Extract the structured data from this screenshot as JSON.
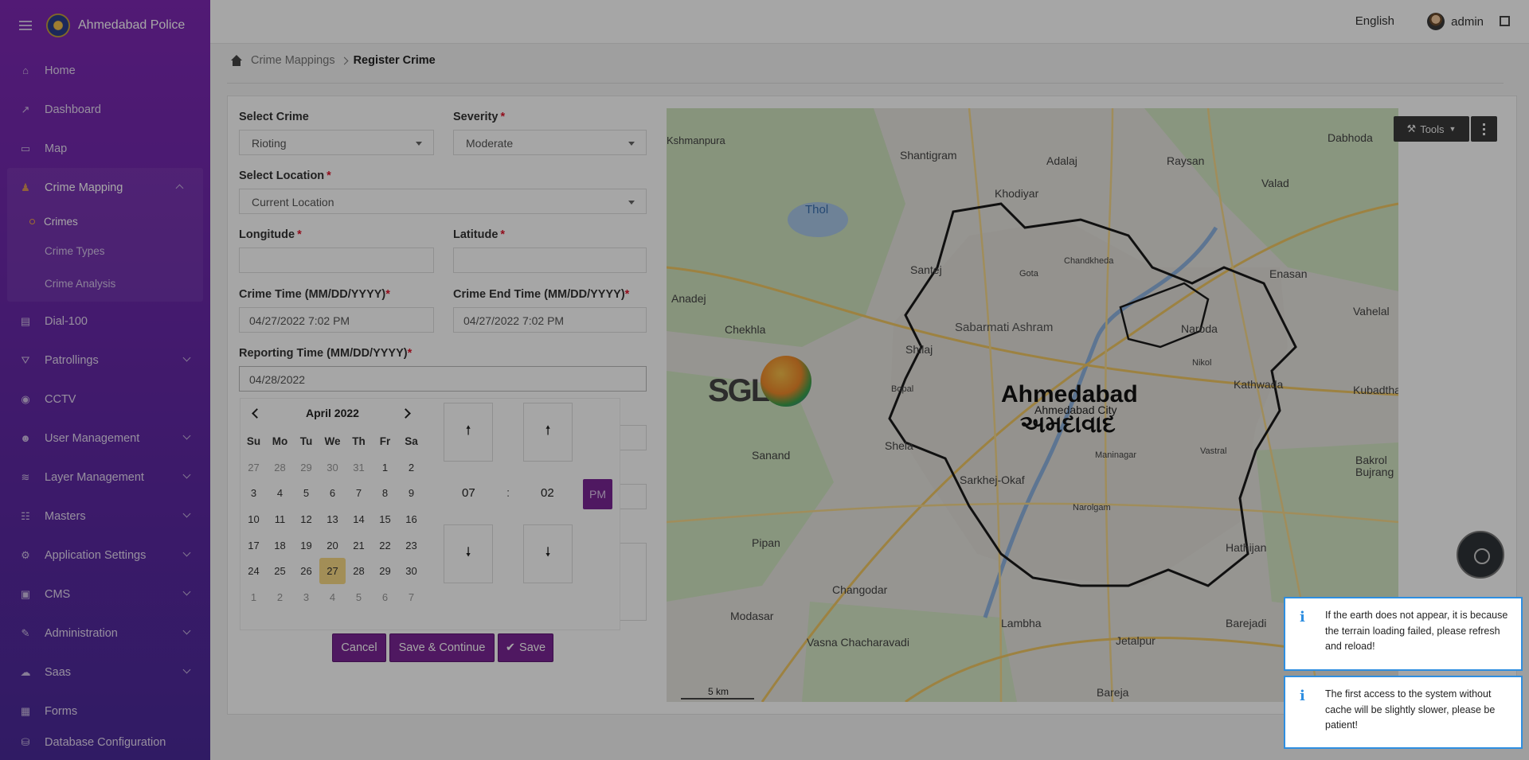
{
  "app": {
    "title": "Ahmedabad Police"
  },
  "topbar": {
    "language": "English",
    "user": "admin"
  },
  "sidebar": {
    "items": [
      {
        "label": "Home"
      },
      {
        "label": "Dashboard"
      },
      {
        "label": "Map"
      },
      {
        "label": "Crime Mapping"
      },
      {
        "label": "Crimes"
      },
      {
        "label": "Crime Types"
      },
      {
        "label": "Crime Analysis"
      },
      {
        "label": "Dial-100"
      },
      {
        "label": "Patrollings"
      },
      {
        "label": "CCTV"
      },
      {
        "label": "User Management"
      },
      {
        "label": "Layer Management"
      },
      {
        "label": "Masters"
      },
      {
        "label": "Application Settings"
      },
      {
        "label": "CMS"
      },
      {
        "label": "Administration"
      },
      {
        "label": "Saas"
      },
      {
        "label": "Forms"
      },
      {
        "label": "Database Configuration"
      }
    ]
  },
  "breadcrumb": {
    "parent": "Crime Mappings",
    "current": "Register Crime"
  },
  "form": {
    "select_crime": {
      "label": "Select Crime",
      "value": "Rioting"
    },
    "severity": {
      "label": "Severity",
      "value": "Moderate"
    },
    "location": {
      "label": "Select Location",
      "value": "Current Location"
    },
    "longitude": {
      "label": "Longitude",
      "value": ""
    },
    "latitude": {
      "label": "Latitude",
      "value": ""
    },
    "crime_time": {
      "label": "Crime Time (MM/DD/YYYY)",
      "value": "04/27/2022 7:02 PM"
    },
    "crime_end_time": {
      "label": "Crime End Time (MM/DD/YYYY)",
      "value": "04/27/2022 7:02 PM"
    },
    "reporting_time": {
      "label": "Reporting Time (MM/DD/YYYY)",
      "value": "04/28/2022"
    },
    "required_mark": "*"
  },
  "datepicker": {
    "month": "April 2022",
    "weekdays": [
      "Su",
      "Mo",
      "Tu",
      "We",
      "Th",
      "Fr",
      "Sa"
    ],
    "weeks": [
      [
        "27",
        "28",
        "29",
        "30",
        "31",
        "1",
        "2"
      ],
      [
        "3",
        "4",
        "5",
        "6",
        "7",
        "8",
        "9"
      ],
      [
        "10",
        "11",
        "12",
        "13",
        "14",
        "15",
        "16"
      ],
      [
        "17",
        "18",
        "19",
        "20",
        "21",
        "22",
        "23"
      ],
      [
        "24",
        "25",
        "26",
        "27",
        "28",
        "29",
        "30"
      ],
      [
        "1",
        "2",
        "3",
        "4",
        "5",
        "6",
        "7"
      ]
    ],
    "hour": "07",
    "minute": "02",
    "separator": ":",
    "meridiem": "PM"
  },
  "buttons": {
    "cancel": "Cancel",
    "save_continue": "Save & Continue",
    "save": "Save"
  },
  "map": {
    "tools": "Tools",
    "city_en": "Ahmedabad",
    "city_gu": "અમદાવાદ",
    "city_sub": "Ahmedabad City",
    "scale": "5 km",
    "logo_text": "SGL",
    "places": [
      "Kshmanpura",
      "Shantigram",
      "Adalaj",
      "Raysan",
      "Dabhoda",
      "Thol",
      "Chandkheda",
      "Gota",
      "Enasan",
      "Vahelal",
      "Anadej",
      "Sabarmati Ashram",
      "Naroda",
      "Chekhla",
      "Shilaj",
      "Nikol",
      "Kathwada",
      "Kubadthal",
      "Bopal",
      "Maninagar",
      "Vastral",
      "Sanand",
      "Shela",
      "Sarkhej-Okaf",
      "Bakrol Bujrang",
      "Narolgam",
      "Pipan",
      "Hathijan",
      "Changodar",
      "Modasar",
      "Vasna Chacharavadi",
      "Lambha",
      "Jetalpur",
      "Barejadi",
      "Bareja",
      "Valad",
      "Khodiyar",
      "Santej"
    ]
  },
  "notices": [
    "If the earth does not appear, it is because the terrain loading failed, please refresh and reload!",
    "The first access to the system without cache will be slightly slower, please be patient!"
  ]
}
